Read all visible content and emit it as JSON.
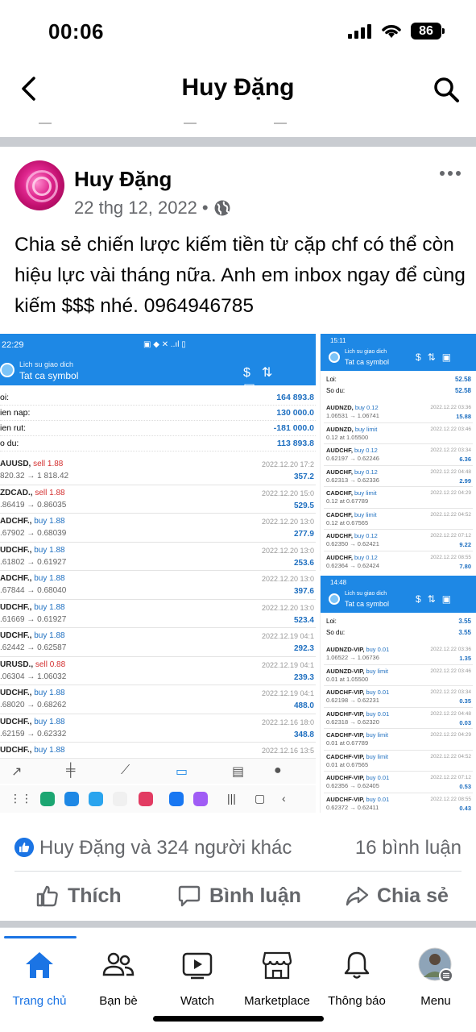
{
  "status_bar": {
    "time": "00:06",
    "battery": "86"
  },
  "nav": {
    "title": "Huy Đặng"
  },
  "post": {
    "author": "Huy Đặng",
    "date": "22 thg 12, 2022",
    "date_separator": "•",
    "caption": "Chia sẻ chiến lược kiếm tiền từ cặp chf có thể còn hiệu lực vài tháng nữa. Anh em inbox ngay để cùng kiếm $$$ nhé. 0964946785"
  },
  "left_screenshot": {
    "status_time": "22:29",
    "header_sub": "Lich su giao dich",
    "header_main": "Tat ca symbol",
    "summary": [
      {
        "k": "oi:",
        "v": "164 893.8"
      },
      {
        "k": "ien nap:",
        "v": "130 000.0"
      },
      {
        "k": "ien rut:",
        "v": "-181 000.0"
      },
      {
        "k": "o du:",
        "v": "113 893.8"
      }
    ],
    "trades": [
      {
        "sym": "AUUSD,",
        "side": "sell 1.88",
        "type": "sell",
        "px": "820.32 → 1 818.42",
        "dt": "2022.12.20 17:2",
        "pl": "357.2"
      },
      {
        "sym": "ZDCAD.,",
        "side": "sell 1.88",
        "type": "sell",
        "px": ".86419 → 0.86035",
        "dt": "2022.12.20 15:0",
        "pl": "529.5"
      },
      {
        "sym": "ADCHF.,",
        "side": "buy 1.88",
        "type": "buy",
        "px": ".67902 → 0.68039",
        "dt": "2022.12.20 13:0",
        "pl": "277.9"
      },
      {
        "sym": "UDCHF.,",
        "side": "buy 1.88",
        "type": "buy",
        "px": ".61802 → 0.61927",
        "dt": "2022.12.20 13:0",
        "pl": "253.6"
      },
      {
        "sym": "ADCHF.,",
        "side": "buy 1.88",
        "type": "buy",
        "px": ".67844 → 0.68040",
        "dt": "2022.12.20 13:0",
        "pl": "397.6"
      },
      {
        "sym": "UDCHF.,",
        "side": "buy 1.88",
        "type": "buy",
        "px": ".61669 → 0.61927",
        "dt": "2022.12.20 13:0",
        "pl": "523.4"
      },
      {
        "sym": "UDCHF.,",
        "side": "buy 1.88",
        "type": "buy",
        "px": ".62442 → 0.62587",
        "dt": "2022.12.19 04:1",
        "pl": "292.3"
      },
      {
        "sym": "URUSD.,",
        "side": "sell 0.88",
        "type": "sell",
        "px": ".06304 → 1.06032",
        "dt": "2022.12.19 04:1",
        "pl": "239.3"
      },
      {
        "sym": "UDCHF.,",
        "side": "buy 1.88",
        "type": "buy",
        "px": ".68020 → 0.68262",
        "dt": "2022.12.19 04:1",
        "pl": "488.0"
      },
      {
        "sym": "UDCHF.,",
        "side": "buy 1.88",
        "type": "buy",
        "px": ".62159 → 0.62332",
        "dt": "2022.12.16 18:0",
        "pl": "348.8"
      },
      {
        "sym": "UDCHF.,",
        "side": "buy 1.88",
        "type": "buy",
        "px": "",
        "dt": "2022.12.16 13:5",
        "pl": ""
      }
    ]
  },
  "right_top": {
    "status_time": "15:11",
    "header_sub": "Lich su giao dich",
    "header_main": "Tat ca symbol",
    "summary": [
      {
        "k": "Loi:",
        "v": "52.58"
      },
      {
        "k": "So du:",
        "v": "52.58"
      }
    ],
    "trades": [
      {
        "sym": "AUDNZD,",
        "side": "buy 0.12",
        "px": "1.06531 → 1.06741",
        "dt": "2022.12.22 03:36",
        "pl": "15.88"
      },
      {
        "sym": "AUDNZD,",
        "side": "buy limit",
        "px": "0.12 at 1.05500",
        "dt": "2022.12.22 03:46",
        "pl": ""
      },
      {
        "sym": "AUDCHF,",
        "side": "buy 0.12",
        "px": "0.62197 → 0.62246",
        "dt": "2022.12.22 03:34",
        "pl": "6.36"
      },
      {
        "sym": "AUDCHF,",
        "side": "buy 0.12",
        "px": "0.62313 → 0.62336",
        "dt": "2022.12.22 04:48",
        "pl": "2.99"
      },
      {
        "sym": "CADCHF,",
        "side": "buy limit",
        "px": "0.12 at 0.67789",
        "dt": "2022.12.22 04:29",
        "pl": ""
      },
      {
        "sym": "CADCHF,",
        "side": "buy limit",
        "px": "0.12 at 0.67565",
        "dt": "2022.12.22 04:52",
        "pl": ""
      },
      {
        "sym": "AUDCHF,",
        "side": "buy 0.12",
        "px": "0.62350 → 0.62421",
        "dt": "2022.12.22 07:12",
        "pl": "9.22"
      },
      {
        "sym": "AUDCHF,",
        "side": "buy 0.12",
        "px": "0.62364 → 0.62424",
        "dt": "2022.12.22 08:55",
        "pl": "7.80"
      }
    ]
  },
  "right_bottom": {
    "status_time": "14:48",
    "header_sub": "Lich su giao dich",
    "header_main": "Tat ca symbol",
    "summary": [
      {
        "k": "Loi:",
        "v": "3.55"
      },
      {
        "k": "So du:",
        "v": "3.55"
      }
    ],
    "trades": [
      {
        "sym": "AUDNZD-VIP,",
        "side": "buy 0.01",
        "px": "1.06522 → 1.06736",
        "dt": "2022.12.22 03:36",
        "pl": "1.35"
      },
      {
        "sym": "AUDNZD-VIP,",
        "side": "buy limit",
        "px": "0.01 at 1.05500",
        "dt": "2022.12.22 03:46",
        "pl": ""
      },
      {
        "sym": "AUDCHF-VIP,",
        "side": "buy 0.01",
        "px": "0.62198 → 0.62231",
        "dt": "2022.12.22 03:34",
        "pl": "0.35"
      },
      {
        "sym": "AUDCHF-VIP,",
        "side": "buy 0.01",
        "px": "0.62318 → 0.62320",
        "dt": "2022.12.22 04:48",
        "pl": "0.03"
      },
      {
        "sym": "CADCHF-VIP,",
        "side": "buy limit",
        "px": "0.01 at 0.67789",
        "dt": "2022.12.22 04:29",
        "pl": ""
      },
      {
        "sym": "CADCHF-VIP,",
        "side": "buy limit",
        "px": "0.01 at 0.67565",
        "dt": "2022.12.22 04:52",
        "pl": ""
      },
      {
        "sym": "AUDCHF-VIP,",
        "side": "buy 0.01",
        "px": "0.62356 → 0.62405",
        "dt": "2022.12.22 07:12",
        "pl": "0.53"
      },
      {
        "sym": "AUDCHF-VIP,",
        "side": "buy 0.01",
        "px": "0.62372 → 0.62411",
        "dt": "2022.12.22 08:55",
        "pl": "0.43"
      }
    ]
  },
  "reactions": {
    "who": "Huy Đặng và 324 người khác",
    "comments": "16 bình luận"
  },
  "actions": {
    "like": "Thích",
    "comment": "Bình luận",
    "share": "Chia sẻ"
  },
  "tabs": [
    {
      "label": "Trang chủ",
      "icon": "home-icon"
    },
    {
      "label": "Bạn bè",
      "icon": "friends-icon"
    },
    {
      "label": "Watch",
      "icon": "watch-icon"
    },
    {
      "label": "Marketplace",
      "icon": "marketplace-icon"
    },
    {
      "label": "Thông báo",
      "icon": "bell-icon"
    },
    {
      "label": "Menu",
      "icon": "menu-avatar-icon"
    }
  ],
  "colors": {
    "accent": "#1b74e4",
    "secondary_text": "#65676b",
    "mt4_header": "#1e88e5"
  }
}
